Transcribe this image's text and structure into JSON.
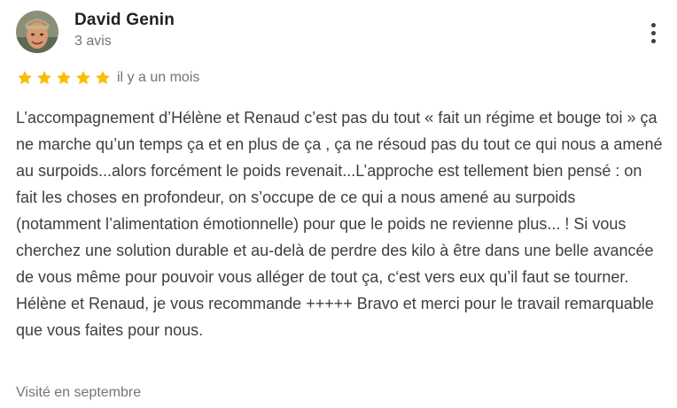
{
  "review": {
    "author": {
      "name": "David Genin",
      "review_count": "3 avis",
      "avatar": "avatar-photo"
    },
    "more_icon": "more-vert-icon",
    "rating": {
      "stars": 5,
      "max": 5,
      "color": "#fbbc04"
    },
    "date": "il y a un mois",
    "text": "L’accompagnement d’Hélène et Renaud c’est pas du tout « fait un régime et bouge toi » ça ne marche qu’un temps ça et en plus de ça , ça ne résoud pas du tout ce qui nous a amené au surpoids...alors forcément le poids revenait...L’approche est tellement bien pensé : on fait les choses en profondeur, on s’occupe de ce qui a nous amené au surpoids (notamment l’alimentation émotionnelle) pour que le poids ne revienne plus... ! Si vous cherchez une solution durable et au-delà de perdre des kilo à être dans une belle avancée de vous même pour pouvoir vous alléger de tout ça, c‘est vers eux qu’il faut se tourner. Hélène et Renaud, je vous recommande +++++ Bravo et merci pour le travail remarquable que vous faites pour nous.",
    "visit": "Visité en septembre"
  }
}
